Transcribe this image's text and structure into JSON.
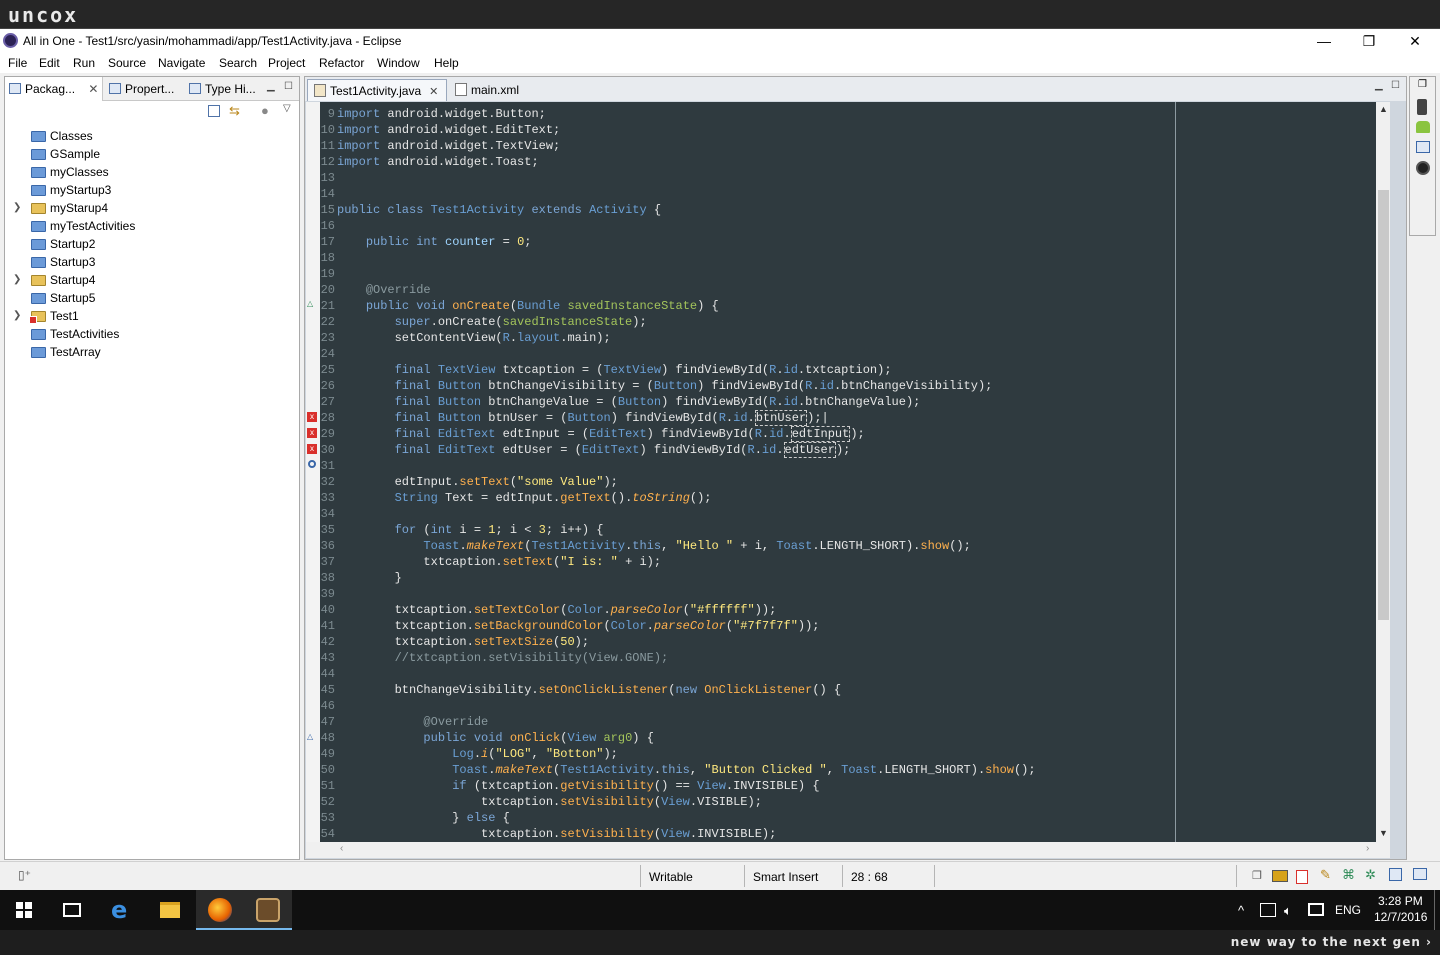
{
  "brand": "uncox",
  "window": {
    "title": "All in One - Test1/src/yasin/mohammadi/app/Test1Activity.java - Eclipse",
    "controls": [
      "—",
      "❐",
      "✕"
    ]
  },
  "menu": [
    "File",
    "Edit",
    "Run",
    "Source",
    "Navigate",
    "Search",
    "Project",
    "Refactor",
    "Window",
    "Help"
  ],
  "package_explorer": {
    "tabs": [
      "Packag...",
      "Propert...",
      "Type Hi..."
    ],
    "items": [
      {
        "label": "Classes",
        "kind": "folder",
        "expandable": false
      },
      {
        "label": "GSample",
        "kind": "folder",
        "expandable": false
      },
      {
        "label": "myClasses",
        "kind": "folder",
        "expandable": false
      },
      {
        "label": "myStartup3",
        "kind": "folder",
        "expandable": false
      },
      {
        "label": "myStarup4",
        "kind": "project",
        "expandable": true
      },
      {
        "label": "myTestActivities",
        "kind": "folder",
        "expandable": false
      },
      {
        "label": "Startup2",
        "kind": "folder",
        "expandable": false
      },
      {
        "label": "Startup3",
        "kind": "folder",
        "expandable": false
      },
      {
        "label": "Startup4",
        "kind": "project",
        "expandable": true
      },
      {
        "label": "Startup5",
        "kind": "folder",
        "expandable": false
      },
      {
        "label": "Test1",
        "kind": "error",
        "expandable": true
      },
      {
        "label": "TestActivities",
        "kind": "folder",
        "expandable": false
      },
      {
        "label": "TestArray",
        "kind": "folder",
        "expandable": false
      }
    ]
  },
  "editor": {
    "tabs": [
      {
        "label": "Test1Activity.java",
        "active": true
      },
      {
        "label": "main.xml",
        "active": false
      }
    ]
  },
  "status": {
    "writable": "Writable",
    "insert_mode": "Smart Insert",
    "position": "28 : 68"
  },
  "taskbar": {
    "time": "3:28 PM",
    "date": "12/7/2016",
    "lang": "ENG"
  },
  "slogan": "new way to the next gen ›"
}
